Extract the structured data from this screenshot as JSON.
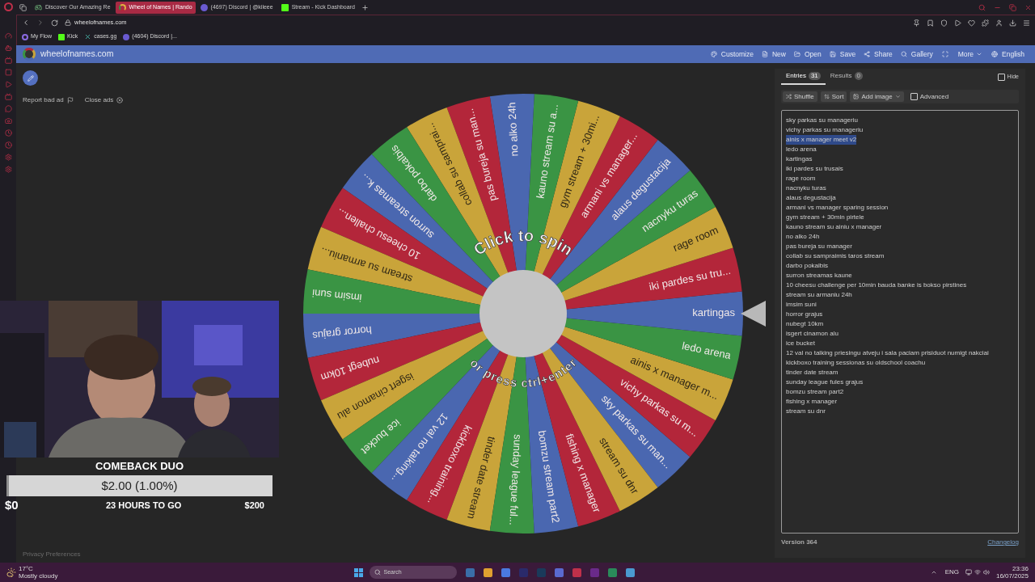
{
  "browser": {
    "tabs": [
      {
        "title": "Discover Our Amazing Re",
        "selected": false
      },
      {
        "title": "Wheel of Names | Rando",
        "selected": true
      },
      {
        "title": "(4697) Discord | @kileee",
        "selected": false
      },
      {
        "title": "Stream - Kick Dashboard",
        "selected": false
      }
    ],
    "url": "wheelofnames.com",
    "bookmarks": [
      "My Flow",
      "Kick",
      "cases.gg",
      "(4604) Discord |..."
    ]
  },
  "header": {
    "site_name": "wheelofnames.com",
    "menu": [
      "Customize",
      "New",
      "Open",
      "Save",
      "Share",
      "Gallery"
    ],
    "more": "More",
    "language": "English"
  },
  "ads": {
    "report": "Report bad ad",
    "close": "Close ads",
    "privacy": "Privacy Preferences"
  },
  "wheel": {
    "spin_text": "Click to spin",
    "spin_hint": "or press ctrl+enter",
    "segments": [
      "sky parkas su man...",
      "vichy parkas su m...",
      "ainis x manager m...",
      "ledo arena",
      "kartingas",
      "iki pardes su tru...",
      "rage room",
      "nacnyku turas",
      "alaus degustacija",
      "armani vs manager...",
      "gym stream + 30mi...",
      "kauno stream su a...",
      "no alko 24h",
      "pas bureja su man...",
      "collab su samprai...",
      "darbo pokalbis",
      "surron streamas k...",
      "10 cheesu challen...",
      "stream su armaniu...",
      "imsim suni",
      "horror grajus",
      "nubegt 10km",
      "isgert cinamon alu",
      "ice bucket",
      "12 val no talking...",
      "kickboxo training...",
      "tinder date stream",
      "sunday league ful...",
      "bomzu stream part2",
      "fishing x manager",
      "stream su dnr"
    ]
  },
  "panel": {
    "tabs": [
      {
        "label": "Entries",
        "count": "31",
        "selected": true
      },
      {
        "label": "Results",
        "count": "0",
        "selected": false
      }
    ],
    "hide": {
      "label": "Hide",
      "checked": false
    },
    "tools": [
      "Shuffle",
      "Sort",
      "Add image"
    ],
    "advanced": {
      "label": "Advanced",
      "checked": false
    },
    "entries": [
      {
        "text": "sky parkas su manageriu",
        "selected": false
      },
      {
        "text": "vichy parkas su manageriu",
        "selected": false
      },
      {
        "text": "ainis x manager meet v2",
        "selected": true
      },
      {
        "text": "ledo arena",
        "selected": false
      },
      {
        "text": "kartingas",
        "selected": false
      },
      {
        "text": "iki pardes su trusais",
        "selected": false
      },
      {
        "text": "rage room",
        "selected": false
      },
      {
        "text": "nacnyku turas",
        "selected": false
      },
      {
        "text": "alaus degustacija",
        "selected": false
      },
      {
        "text": "armani vs manager sparing session",
        "selected": false
      },
      {
        "text": "gym stream + 30min pirtele",
        "selected": false
      },
      {
        "text": "kauno stream su ainiu x manager",
        "selected": false
      },
      {
        "text": "no alko 24h",
        "selected": false
      },
      {
        "text": "pas bureja su manager",
        "selected": false
      },
      {
        "text": "collab su sampraimis taros stream",
        "selected": false
      },
      {
        "text": "darbo pokalbis",
        "selected": false
      },
      {
        "text": "surron streamas kaune",
        "selected": false
      },
      {
        "text": "10 cheesu challenge per 10min bauda banke is bokso pirstines",
        "selected": false
      },
      {
        "text": "stream su armaniu 24h",
        "selected": false
      },
      {
        "text": "imsim suni",
        "selected": false
      },
      {
        "text": "horror grajus",
        "selected": false
      },
      {
        "text": "nubegt 10km",
        "selected": false
      },
      {
        "text": "isgert cinamon alu",
        "selected": false
      },
      {
        "text": "ice bucket",
        "selected": false
      },
      {
        "text": "12 val no talking priesingu atveju i sala paciam prisiduot numigt nakciai",
        "selected": false
      },
      {
        "text": "kickboxo training sessionas su oldschool coachu",
        "selected": false
      },
      {
        "text": "tinder date stream",
        "selected": false
      },
      {
        "text": "sunday league fules grajus",
        "selected": false
      },
      {
        "text": "bomzu stream part2",
        "selected": false
      },
      {
        "text": "fishing x manager",
        "selected": false
      },
      {
        "text": "stream su dnr",
        "selected": false
      }
    ],
    "version": "Version 364",
    "changelog": "Changelog"
  },
  "goal": {
    "title": "COMEBACK DUO",
    "amount": "$2.00 (1.00%)",
    "level": 0.01,
    "min": "$0",
    "remaining": "23 HOURS TO GO",
    "max": "$200"
  },
  "taskbar": {
    "temperature": "17°C",
    "weather": "Mostly cloudy",
    "search": "Search",
    "language": "ENG",
    "time": "23:36",
    "date": "16/07/2025"
  }
}
